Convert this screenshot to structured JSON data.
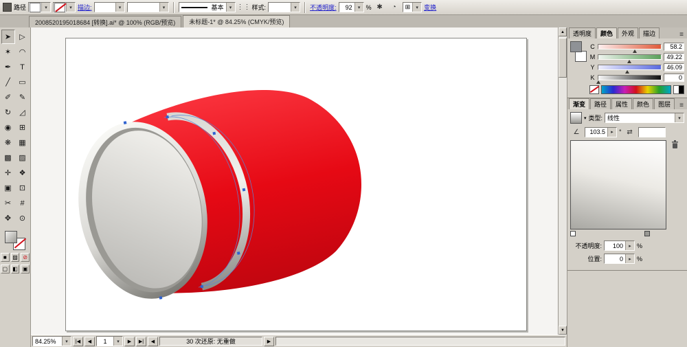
{
  "controlbar": {
    "panel_label": "路径",
    "stroke_label": "描边:",
    "basic_label": "基本",
    "style_label": "样式:",
    "opacity_label": "不透明度:",
    "opacity_value": "92",
    "percent": "%",
    "transform_label": "变换"
  },
  "doc_tabs": [
    {
      "title": "2008520195018684 [转换].ai* @ 100% (RGB/预览)"
    },
    {
      "title": "未标题-1* @ 84.25% (CMYK/预览)"
    }
  ],
  "tools": [
    {
      "name": "selection",
      "glyph": "➤"
    },
    {
      "name": "direct-selection",
      "glyph": "▷"
    },
    {
      "name": "magic-wand",
      "glyph": "✶"
    },
    {
      "name": "lasso",
      "glyph": "◠"
    },
    {
      "name": "pen",
      "glyph": "✒"
    },
    {
      "name": "type",
      "glyph": "T"
    },
    {
      "name": "line-segment",
      "glyph": "╱"
    },
    {
      "name": "rectangle",
      "glyph": "▭"
    },
    {
      "name": "paintbrush",
      "glyph": "✐"
    },
    {
      "name": "pencil",
      "glyph": "✎"
    },
    {
      "name": "rotate",
      "glyph": "↻"
    },
    {
      "name": "scale",
      "glyph": "◿"
    },
    {
      "name": "warp",
      "glyph": "◉"
    },
    {
      "name": "free-transform",
      "glyph": "⊞"
    },
    {
      "name": "symbol-sprayer",
      "glyph": "❋"
    },
    {
      "name": "graph",
      "glyph": "▦"
    },
    {
      "name": "mesh",
      "glyph": "▩"
    },
    {
      "name": "gradient",
      "glyph": "▨"
    },
    {
      "name": "eyedropper",
      "glyph": "✛"
    },
    {
      "name": "blend",
      "glyph": "❖"
    },
    {
      "name": "live-paint-bucket",
      "glyph": "▣"
    },
    {
      "name": "live-paint-selection",
      "glyph": "⊡"
    },
    {
      "name": "scissors",
      "glyph": "✂"
    },
    {
      "name": "slice",
      "glyph": "#"
    },
    {
      "name": "hand",
      "glyph": "✥"
    },
    {
      "name": "zoom",
      "glyph": "⊙"
    }
  ],
  "toolbar_bottom": {
    "mini_fill": "■",
    "mini_gradient": "▨",
    "mini_none": "⊘",
    "screen_modes": [
      "▢",
      "◧",
      "▣"
    ]
  },
  "color_panel": {
    "menu_icon": "≡",
    "tabs": [
      "透明度",
      "颜色",
      "外观",
      "描边"
    ],
    "channels": [
      {
        "label": "C",
        "value": "58.2"
      },
      {
        "label": "M",
        "value": "49.22"
      },
      {
        "label": "Y",
        "value": "46.09"
      },
      {
        "label": "K",
        "value": "0"
      }
    ]
  },
  "gradient_panel": {
    "menu_icon": "≡",
    "tabs": [
      "渐变",
      "路径",
      "属性",
      "颜色",
      "图层"
    ],
    "type_label": "类型:",
    "type_value": "线性",
    "angle_icon": "∠",
    "reverse_icon": "⇄",
    "angle_value": "103.5",
    "degree_symbol": "°",
    "opacity_label": "不透明度:",
    "opacity_value": "100",
    "position_label": "位置:",
    "position_value": "0",
    "percent": "%"
  },
  "statusbar": {
    "zoom": "84.25%",
    "first_glyph": "|◀",
    "prev_glyph": "◀",
    "page": "1",
    "next_glyph": "▶",
    "last_glyph": "▶|",
    "hist_prev": "◀",
    "history": "30 次还原: 无重做",
    "hist_next": "▶"
  },
  "artwork": {
    "red_top": "#fb3640",
    "red_mid": "#e60914",
    "red_bottom": "#bd050f",
    "silver_light": "#f2f1ee",
    "silver_mid": "#d8d7d3",
    "silver_dark": "#8e8d89",
    "rim_light": "#fafaf7",
    "rim_dark": "#75746f",
    "face_light": "#edece8",
    "face_dark": "#b7b6b2",
    "selection_blue": "#2f62d0"
  }
}
